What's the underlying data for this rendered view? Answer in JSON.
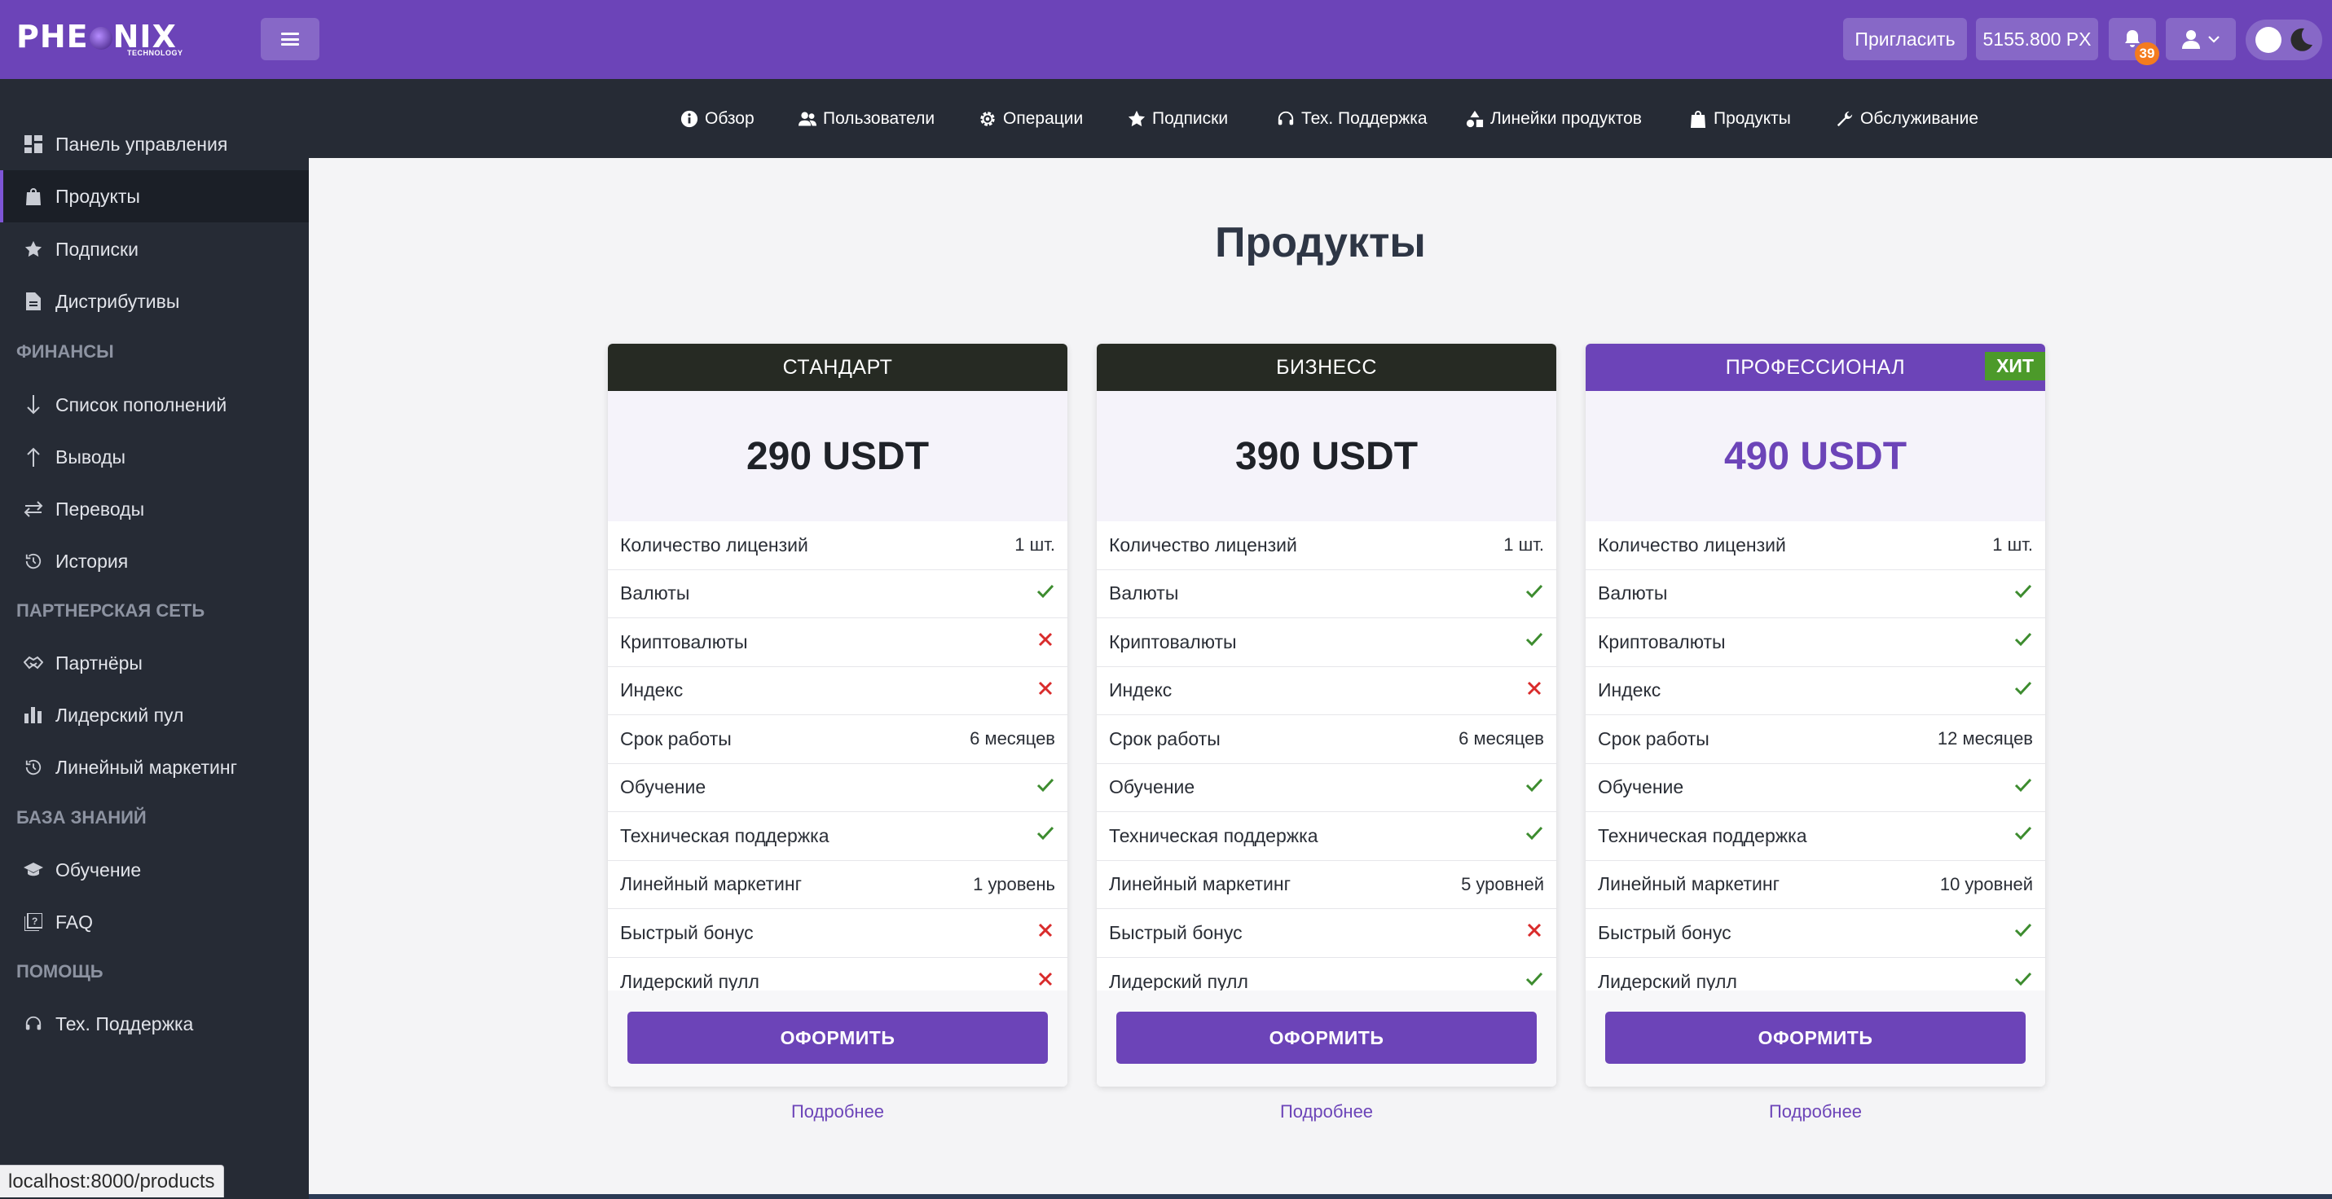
{
  "header": {
    "logo_text_left": "PHE",
    "logo_text_right": "NIX",
    "logo_subtext": "TECHNOLOGY",
    "invite_label": "Пригласить",
    "balance": "5155.800 PX",
    "notification_count": "39"
  },
  "sidebar": {
    "items": [
      {
        "label": "Панель управления",
        "icon": "dashboard-icon"
      },
      {
        "label": "Продукты",
        "icon": "bag-icon",
        "active": true
      },
      {
        "label": "Подписки",
        "icon": "star-icon"
      },
      {
        "label": "Дистрибутивы",
        "icon": "document-icon"
      }
    ],
    "sections": {
      "finance": "ФИНАНСЫ",
      "partners": "ПАРТНЕРСКАЯ СЕТЬ",
      "knowledge": "БАЗА ЗНАНИЙ",
      "help": "ПОМОЩЬ"
    },
    "finance_items": [
      {
        "label": "Список пополнений",
        "icon": "arrow-down-icon"
      },
      {
        "label": "Выводы",
        "icon": "arrow-up-icon"
      },
      {
        "label": "Переводы",
        "icon": "transfer-icon"
      },
      {
        "label": "История",
        "icon": "history-icon"
      }
    ],
    "partner_items": [
      {
        "label": "Партнёры",
        "icon": "handshake-icon"
      },
      {
        "label": "Лидерский пул",
        "icon": "bar-chart-icon"
      },
      {
        "label": "Линейный маркетинг",
        "icon": "history-icon"
      }
    ],
    "knowledge_items": [
      {
        "label": "Обучение",
        "icon": "graduation-cap-icon"
      },
      {
        "label": "FAQ",
        "icon": "faq-icon"
      }
    ],
    "help_items": [
      {
        "label": "Тех. Поддержка",
        "icon": "headset-icon"
      }
    ]
  },
  "subnav": {
    "items": [
      {
        "label": "Обзор",
        "icon": "info-icon"
      },
      {
        "label": "Пользователи",
        "icon": "users-icon"
      },
      {
        "label": "Операции",
        "icon": "cog-icon"
      },
      {
        "label": "Подписки",
        "icon": "star-icon"
      },
      {
        "label": "Тех. Поддержка",
        "icon": "headset-icon"
      },
      {
        "label": "Линейки продуктов",
        "icon": "shapes-icon"
      },
      {
        "label": "Продукты",
        "icon": "bag-icon"
      },
      {
        "label": "Обслуживание",
        "icon": "wrench-icon"
      }
    ]
  },
  "main": {
    "title": "Продукты",
    "order_label": "ОФОРМИТЬ",
    "more_label": "Подробнее",
    "hit_badge": "ХИТ",
    "row_labels": [
      "Количество лицензий",
      "Валюты",
      "Криптовалюты",
      "Индекс",
      "Срок работы",
      "Обучение",
      "Техническая поддержка",
      "Линейный маркетинг",
      "Быстрый бонус",
      "Лидерский пулл"
    ],
    "plans": [
      {
        "name": "СТАНДАРТ",
        "price": "290 USDT",
        "values": [
          "1 шт.",
          "yes",
          "no",
          "no",
          "6 месяцев",
          "yes",
          "yes",
          "1 уровень",
          "no",
          "no"
        ]
      },
      {
        "name": "БИЗНЕСС",
        "price": "390 USDT",
        "values": [
          "1 шт.",
          "yes",
          "yes",
          "no",
          "6 месяцев",
          "yes",
          "yes",
          "5 уровней",
          "no",
          "yes"
        ]
      },
      {
        "name": "ПРОФЕССИОНАЛ",
        "price": "490 USDT",
        "values": [
          "1 шт.",
          "yes",
          "yes",
          "yes",
          "12 месяцев",
          "yes",
          "yes",
          "10 уровней",
          "yes",
          "yes"
        ]
      }
    ]
  },
  "status_bar": {
    "url": "localhost:8000/products"
  },
  "colors": {
    "primary": "#6c44b8",
    "sidebar_bg": "#262b35",
    "check": "#3d8c2f",
    "cross": "#d92b2b"
  }
}
